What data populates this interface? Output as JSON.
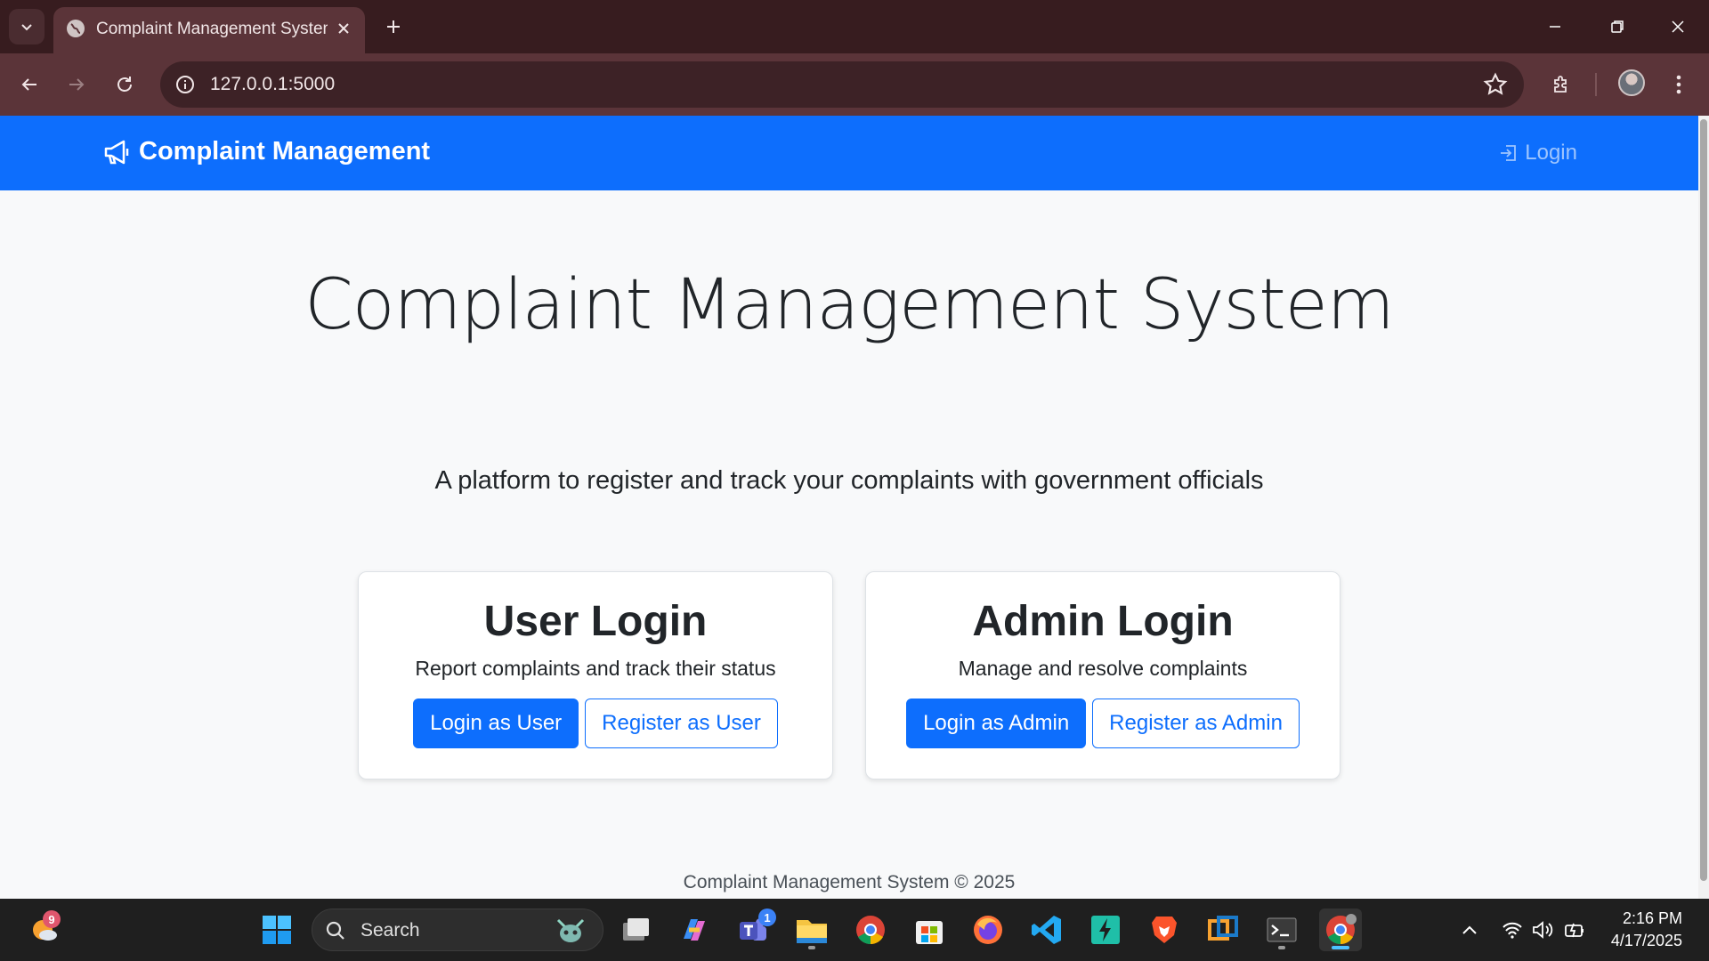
{
  "browser": {
    "tab_title": "Complaint Management System",
    "url": "127.0.0.1:5000"
  },
  "navbar": {
    "brand": "Complaint Management",
    "login_link": "Login"
  },
  "hero": {
    "title": "Complaint Management System",
    "subtitle": "A platform to register and track your complaints with government officials"
  },
  "cards": [
    {
      "title": "User Login",
      "description": "Report complaints and track their status",
      "primary_button": "Login as User",
      "secondary_button": "Register as User"
    },
    {
      "title": "Admin Login",
      "description": "Manage and resolve complaints",
      "primary_button": "Login as Admin",
      "secondary_button": "Register as Admin"
    }
  ],
  "footer": {
    "text": "Complaint Management System © 2025"
  },
  "taskbar": {
    "weather_badge": "9",
    "search_label": "Search",
    "teams_badge": "1",
    "time": "2:16 PM",
    "date": "4/17/2025"
  },
  "colors": {
    "navbar": "#0d6efd",
    "primary": "#0d6efd",
    "page_bg": "#f8f9fa",
    "tab_strip": "#371c1f",
    "toolbar": "#5b3439"
  }
}
